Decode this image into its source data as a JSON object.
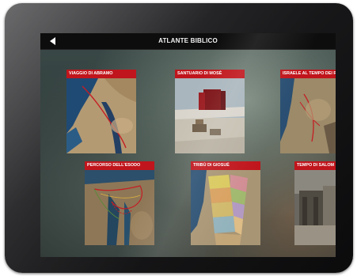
{
  "app": {
    "title": "ATLANTE BIBLICO",
    "back_icon": "back-arrow-icon"
  },
  "tiles": [
    {
      "label": "VIAGGIO DI ABRAMO",
      "thumbnail": "map-thumbnail"
    },
    {
      "label": "SANTUARIO DI MOSÈ",
      "thumbnail": "tabernacle-3d-thumbnail"
    },
    {
      "label": "ISRAELE AL TEMPO DEI RE",
      "thumbnail": "map-thumbnail"
    },
    {
      "label": "PERCORSO DELL'ESODO",
      "thumbnail": "exodus-route-map-thumbnail"
    },
    {
      "label": "TRIBÙ DI GIOSUÈ",
      "thumbnail": "tribes-map-thumbnail"
    },
    {
      "label": "TEMPO DI SALOM",
      "thumbnail": "temple-3d-thumbnail"
    }
  ],
  "colors": {
    "label_bar": "#c0151c",
    "top_bar": "#0d0d0d",
    "bezel": "#1c1c1e"
  }
}
